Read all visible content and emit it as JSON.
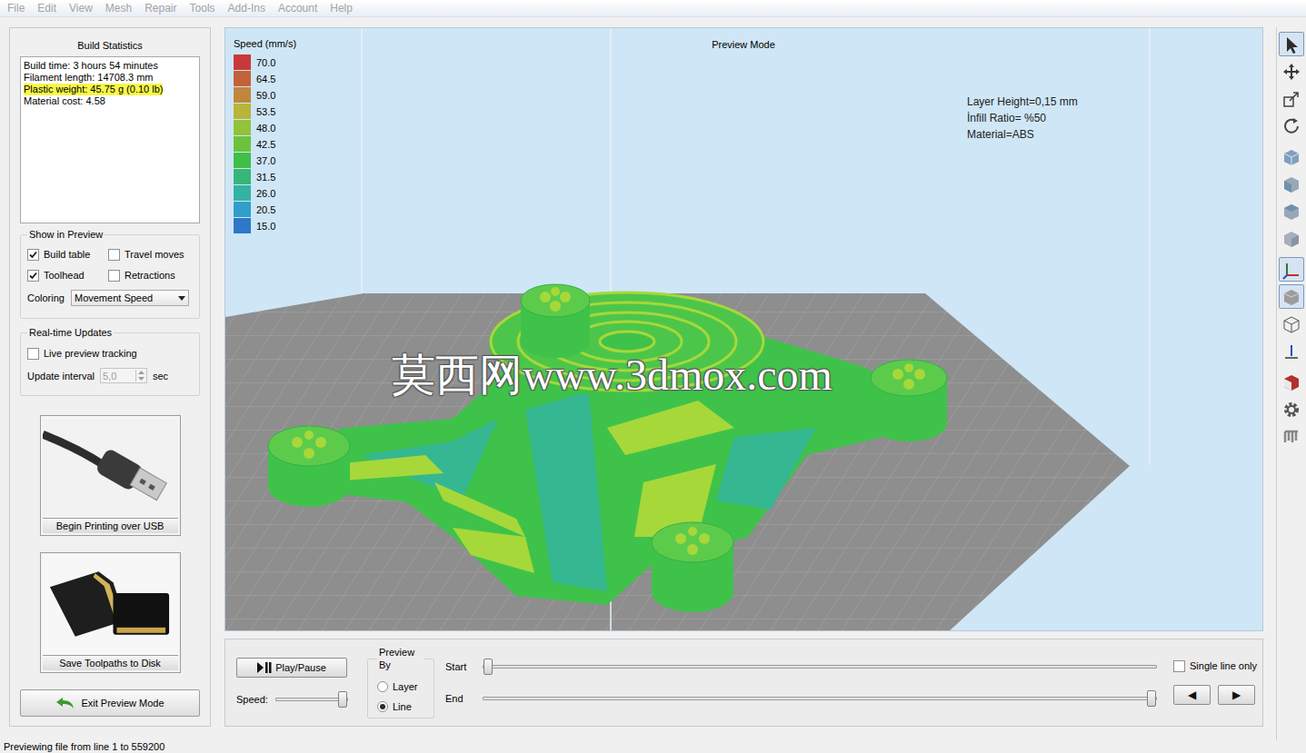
{
  "menu": [
    {
      "label": "File",
      "disabled": true
    },
    {
      "label": "Edit",
      "disabled": true
    },
    {
      "label": "View",
      "disabled": true
    },
    {
      "label": "Mesh",
      "disabled": true
    },
    {
      "label": "Repair",
      "disabled": true
    },
    {
      "label": "Tools",
      "disabled": true
    },
    {
      "label": "Add-Ins",
      "disabled": true
    },
    {
      "label": "Account",
      "disabled": true
    },
    {
      "label": "Help",
      "disabled": true
    }
  ],
  "build_statistics": {
    "title": "Build Statistics",
    "lines": [
      {
        "text": "Build time: 3 hours 54 minutes",
        "highlighted": false
      },
      {
        "text": "Filament length: 14708.3 mm",
        "highlighted": false
      },
      {
        "text": "Plastic weight: 45.75 g (0.10 lb)",
        "highlighted": true
      },
      {
        "text": "Material cost: 4.58",
        "highlighted": false
      }
    ]
  },
  "show_in_preview": {
    "title": "Show in Preview",
    "options": [
      {
        "label": "Build table",
        "checked": true
      },
      {
        "label": "Travel moves",
        "checked": false
      },
      {
        "label": "Toolhead",
        "checked": true
      },
      {
        "label": "Retractions",
        "checked": false
      }
    ],
    "coloring_label": "Coloring",
    "coloring_value": "Movement Speed"
  },
  "realtime_updates": {
    "title": "Real-time Updates",
    "live_tracking": {
      "label": "Live preview tracking",
      "checked": false
    },
    "interval_label": "Update interval",
    "interval_value": "5,0",
    "interval_disabled": true,
    "interval_unit": "sec"
  },
  "actions": [
    {
      "label": "Begin Printing over USB",
      "kind": "usb"
    },
    {
      "label": "Save Toolpaths to Disk",
      "kind": "sd"
    }
  ],
  "exit_button": {
    "label": "Exit Preview Mode"
  },
  "viewport": {
    "title": "Preview Mode",
    "legend": {
      "title": "Speed (mm/s)",
      "items": [
        {
          "value": "70.0",
          "color": "#c83a3a"
        },
        {
          "value": "64.5",
          "color": "#c4603a"
        },
        {
          "value": "59.0",
          "color": "#c0873c"
        },
        {
          "value": "53.5",
          "color": "#b7b53a"
        },
        {
          "value": "48.0",
          "color": "#93c23b"
        },
        {
          "value": "42.5",
          "color": "#6cc23c"
        },
        {
          "value": "37.0",
          "color": "#3fbf48"
        },
        {
          "value": "31.5",
          "color": "#36b679"
        },
        {
          "value": "26.0",
          "color": "#33b3a3"
        },
        {
          "value": "20.5",
          "color": "#2f9fc9"
        },
        {
          "value": "15.0",
          "color": "#2f77c8"
        }
      ]
    },
    "notes": [
      "Layer Height=0,15 mm",
      "İnfill Ratio= %50",
      "Material=ABS"
    ],
    "watermark": "莫西网www.3dmox.com"
  },
  "playback": {
    "play_label": "Play/Pause",
    "speed_label": "Speed:",
    "speed_level": 1,
    "preview_by": {
      "title": "Preview By",
      "options": [
        {
          "label": "Layer",
          "selected": false
        },
        {
          "label": "Line",
          "selected": true
        }
      ]
    },
    "start": {
      "label": "Start",
      "level": 0
    },
    "end": {
      "label": "End",
      "level": 1
    },
    "single_line": {
      "label": "Single line only",
      "checked": false
    },
    "nav": [
      {
        "label": "◀"
      },
      {
        "label": "▶"
      }
    ]
  },
  "toolbar": [
    {
      "kind": "select",
      "selected": true
    },
    {
      "kind": "move",
      "selected": false
    },
    {
      "kind": "scale",
      "selected": false
    },
    {
      "kind": "rotate",
      "selected": false
    },
    {
      "kind": "view-iso",
      "selected": false
    },
    {
      "kind": "view-front",
      "selected": false
    },
    {
      "kind": "view-top",
      "selected": false
    },
    {
      "kind": "view-side",
      "selected": false
    },
    {
      "kind": "axes",
      "selected": true
    },
    {
      "kind": "solid",
      "selected": true
    },
    {
      "kind": "wireframe",
      "selected": false
    },
    {
      "kind": "normals",
      "selected": false
    },
    {
      "kind": "section",
      "selected": false
    },
    {
      "kind": "settings",
      "selected": false
    },
    {
      "kind": "tools",
      "selected": false
    }
  ],
  "status_bar": "Previewing file from line 1 to 559200"
}
